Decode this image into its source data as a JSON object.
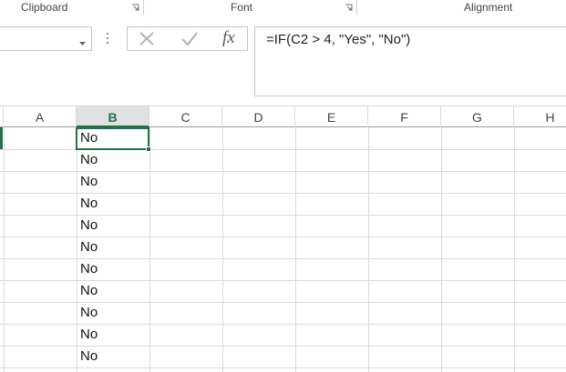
{
  "ribbon": {
    "groups": [
      {
        "label": "Clipboard"
      },
      {
        "label": "Font"
      },
      {
        "label": "Alignment"
      }
    ]
  },
  "formula_bar": {
    "name_box": "",
    "fx_label": "fx",
    "formula": "=IF(C2 > 4, \"Yes\", \"No\")"
  },
  "grid": {
    "columns": [
      "A",
      "B",
      "C",
      "D",
      "E",
      "F",
      "G",
      "H"
    ],
    "active_column": "B",
    "column_b_values": [
      "No",
      "No",
      "No",
      "No",
      "No",
      "No",
      "No",
      "No",
      "No",
      "No",
      "No"
    ]
  },
  "colors": {
    "accent": "#217346",
    "gridline": "#dadada",
    "header_active_bg": "#e1e1e1"
  }
}
